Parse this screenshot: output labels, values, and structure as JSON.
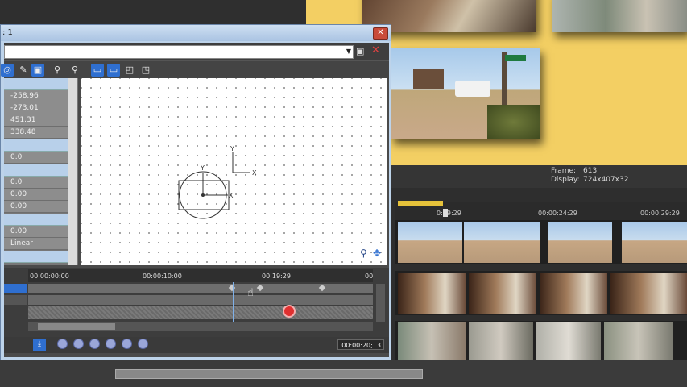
{
  "window": {
    "title": ": 1",
    "close_label": "✕"
  },
  "toolbar": {
    "save_icon": "save-icon",
    "delete_label": "✕"
  },
  "properties": {
    "values": [
      "-258.96",
      "-273.01",
      "451.31",
      "338.48",
      "0.0",
      "0.0",
      "0.00",
      "0.00",
      "0.00",
      "Linear"
    ]
  },
  "canvas": {
    "axis_y_outer": "Y",
    "axis_x_outer": "X",
    "axis_y_inner": "Y",
    "axis_x_inner": "X"
  },
  "keyframe_timeline": {
    "ticks": [
      "00:00:00:00",
      "00:00:10:00",
      "00:19:29",
      "00"
    ],
    "timecode": "00:00:20;13"
  },
  "frame_info": {
    "frame_label": "Frame:",
    "frame_value": "613",
    "display_label": "Display:",
    "display_value": "724x407x32"
  },
  "main_timeline": {
    "ticks": [
      "0:19:29",
      "00:00:24:29",
      "00:00:29:29"
    ]
  },
  "colors": {
    "preview_bg": "#f3cf63",
    "accent_blue": "#2f6fd0",
    "delete_red": "#e04040"
  }
}
